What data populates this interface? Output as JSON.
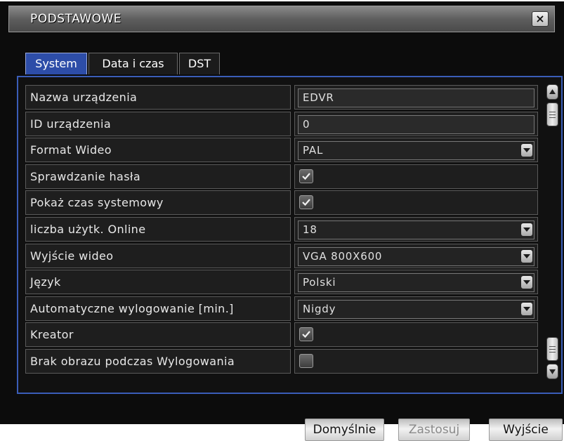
{
  "window": {
    "title": "PODSTAWOWE",
    "close_icon": "close-icon",
    "close_glyph": "×"
  },
  "tabs": [
    {
      "label": "System",
      "active": true
    },
    {
      "label": "Data i czas",
      "active": false
    },
    {
      "label": "DST",
      "active": false
    }
  ],
  "settings": [
    {
      "label": "Nazwa urządzenia",
      "type": "text",
      "value": "EDVR"
    },
    {
      "label": "ID urządzenia",
      "type": "text",
      "value": "0"
    },
    {
      "label": "Format Wideo",
      "type": "select",
      "value": "PAL"
    },
    {
      "label": "Sprawdzanie hasła",
      "type": "checkbox",
      "checked": true
    },
    {
      "label": "Pokaż czas systemowy",
      "type": "checkbox",
      "checked": true
    },
    {
      "label": "liczba użytk. Online",
      "type": "select",
      "value": "18"
    },
    {
      "label": "Wyjście wideo",
      "type": "select",
      "value": "VGA 800X600"
    },
    {
      "label": "Język",
      "type": "select",
      "value": "Polski"
    },
    {
      "label": "Automatyczne wylogowanie [min.]",
      "type": "select",
      "value": "Nigdy"
    },
    {
      "label": "Kreator",
      "type": "checkbox",
      "checked": true
    },
    {
      "label": "Brak obrazu podczas Wylogowania",
      "type": "checkbox",
      "checked": false
    }
  ],
  "buttons": {
    "default_label": "Domyślnie",
    "apply_label": "Zastosuj",
    "apply_enabled": false,
    "exit_label": "Wyjście"
  },
  "colors": {
    "accent": "#2d4da8",
    "panel_border": "#3a5db8",
    "background": "#0c0c0c"
  }
}
